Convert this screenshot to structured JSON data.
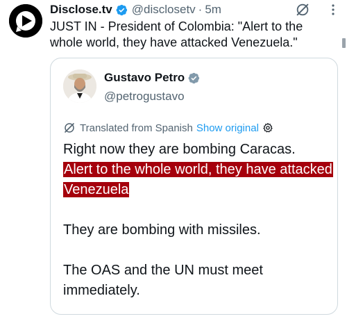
{
  "post": {
    "author_name": "Disclose.tv",
    "handle": "@disclosetv",
    "separator": "·",
    "time": "5m",
    "text": "JUST IN - President of Colombia: \"Alert to the whole world, they have attacked Venezuela.\""
  },
  "quoted": {
    "author_name": "Gustavo Petro",
    "handle": "@petrogustavo",
    "translated_label": "Translated from Spanish",
    "show_original_label": "Show original",
    "line1": "Right now they are bombing Caracas.",
    "highlighted": "Alert to the whole world, they have attacked Venezuela",
    "para2": "They are bombing with missiles.",
    "para3": "The OAS and the UN must meet immediately."
  },
  "icons": {
    "avatar_main": "disclose-play-logo",
    "verified": "verified-badge-icon",
    "grok": "grok-icon",
    "more": "more-icon",
    "translate": "globe-translate-icon",
    "settings": "gear-icon"
  },
  "colors": {
    "verified_blue": "#1d9bf0",
    "verified_gray": "#829aab",
    "highlight": "#a5000c",
    "link": "#1d9bf0",
    "muted": "#536471"
  }
}
